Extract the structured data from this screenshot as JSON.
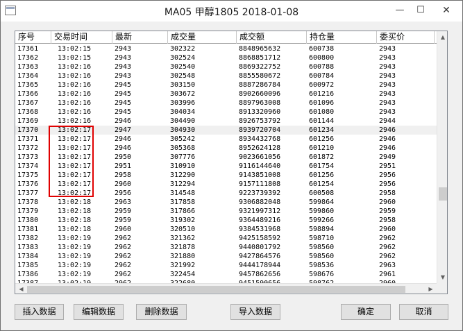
{
  "window": {
    "title": "MA05 甲醇1805 2018-01-08"
  },
  "titlebar": {
    "minimize_icon": "—",
    "maximize_icon": "☐",
    "close_icon": "✕"
  },
  "table": {
    "columns": [
      "序号",
      "交易时间",
      "最新",
      "成交量",
      "成交额",
      "持仓量",
      "委买价",
      ""
    ],
    "rows": [
      [
        "17361",
        "13:02:15",
        "2943",
        "302322",
        "8848965632",
        "600738",
        "2943",
        ""
      ],
      [
        "17362",
        "13:02:15",
        "2943",
        "302524",
        "8868851712",
        "600800",
        "2943",
        ""
      ],
      [
        "17363",
        "13:02:16",
        "2943",
        "302540",
        "8869322752",
        "600788",
        "2943",
        ""
      ],
      [
        "17364",
        "13:02:16",
        "2943",
        "302548",
        "8855580672",
        "600784",
        "2943",
        ""
      ],
      [
        "17365",
        "13:02:16",
        "2945",
        "303150",
        "8887286784",
        "600972",
        "2943",
        ""
      ],
      [
        "17366",
        "13:02:16",
        "2945",
        "303672",
        "8902660096",
        "601216",
        "2943",
        ""
      ],
      [
        "17367",
        "13:02:16",
        "2945",
        "303996",
        "8897963008",
        "601096",
        "2943",
        ""
      ],
      [
        "17368",
        "13:02:16",
        "2945",
        "304034",
        "8913320960",
        "601080",
        "2943",
        ""
      ],
      [
        "17369",
        "13:02:16",
        "2946",
        "304490",
        "8926753792",
        "601144",
        "2944",
        ""
      ],
      [
        "17370",
        "13:02:17",
        "2947",
        "304930",
        "8939720704",
        "601234",
        "2946",
        ""
      ],
      [
        "17371",
        "13:02:17",
        "2946",
        "305242",
        "8934432768",
        "601256",
        "2946",
        ""
      ],
      [
        "17372",
        "13:02:17",
        "2946",
        "305368",
        "8952624128",
        "601210",
        "2946",
        ""
      ],
      [
        "17373",
        "13:02:17",
        "2950",
        "307776",
        "9023661056",
        "601872",
        "2949",
        ""
      ],
      [
        "17374",
        "13:02:17",
        "2951",
        "310910",
        "9116144640",
        "601754",
        "2951",
        ""
      ],
      [
        "17375",
        "13:02:17",
        "2958",
        "312290",
        "9143851008",
        "601256",
        "2956",
        ""
      ],
      [
        "17376",
        "13:02:17",
        "2960",
        "312294",
        "9157111808",
        "601254",
        "2956",
        ""
      ],
      [
        "17377",
        "13:02:17",
        "2956",
        "314548",
        "9223739392",
        "600508",
        "2958",
        ""
      ],
      [
        "17378",
        "13:02:18",
        "2963",
        "317858",
        "9306882048",
        "599864",
        "2960",
        ""
      ],
      [
        "17379",
        "13:02:18",
        "2959",
        "317866",
        "9321997312",
        "599860",
        "2959",
        ""
      ],
      [
        "17380",
        "13:02:18",
        "2959",
        "319302",
        "9364489216",
        "599266",
        "2958",
        ""
      ],
      [
        "17381",
        "13:02:18",
        "2960",
        "320510",
        "9384531968",
        "598894",
        "2960",
        ""
      ],
      [
        "17382",
        "13:02:19",
        "2962",
        "321362",
        "9425158592",
        "598710",
        "2962",
        ""
      ],
      [
        "17383",
        "13:02:19",
        "2962",
        "321878",
        "9440801792",
        "598560",
        "2962",
        ""
      ],
      [
        "17384",
        "13:02:19",
        "2962",
        "321880",
        "9427864576",
        "598560",
        "2962",
        ""
      ],
      [
        "17385",
        "13:02:19",
        "2962",
        "321992",
        "9444178944",
        "598536",
        "2963",
        ""
      ],
      [
        "17386",
        "13:02:19",
        "2962",
        "322454",
        "9457862656",
        "598676",
        "2961",
        ""
      ],
      [
        "17387",
        "13:02:19",
        "2962",
        "322680",
        "9451590656",
        "598762",
        "2960",
        ""
      ]
    ]
  },
  "buttons": {
    "insert": "插入数据",
    "edit": "编辑数据",
    "delete": "删除数据",
    "import": "导入数据",
    "ok": "确定",
    "cancel": "取消"
  }
}
